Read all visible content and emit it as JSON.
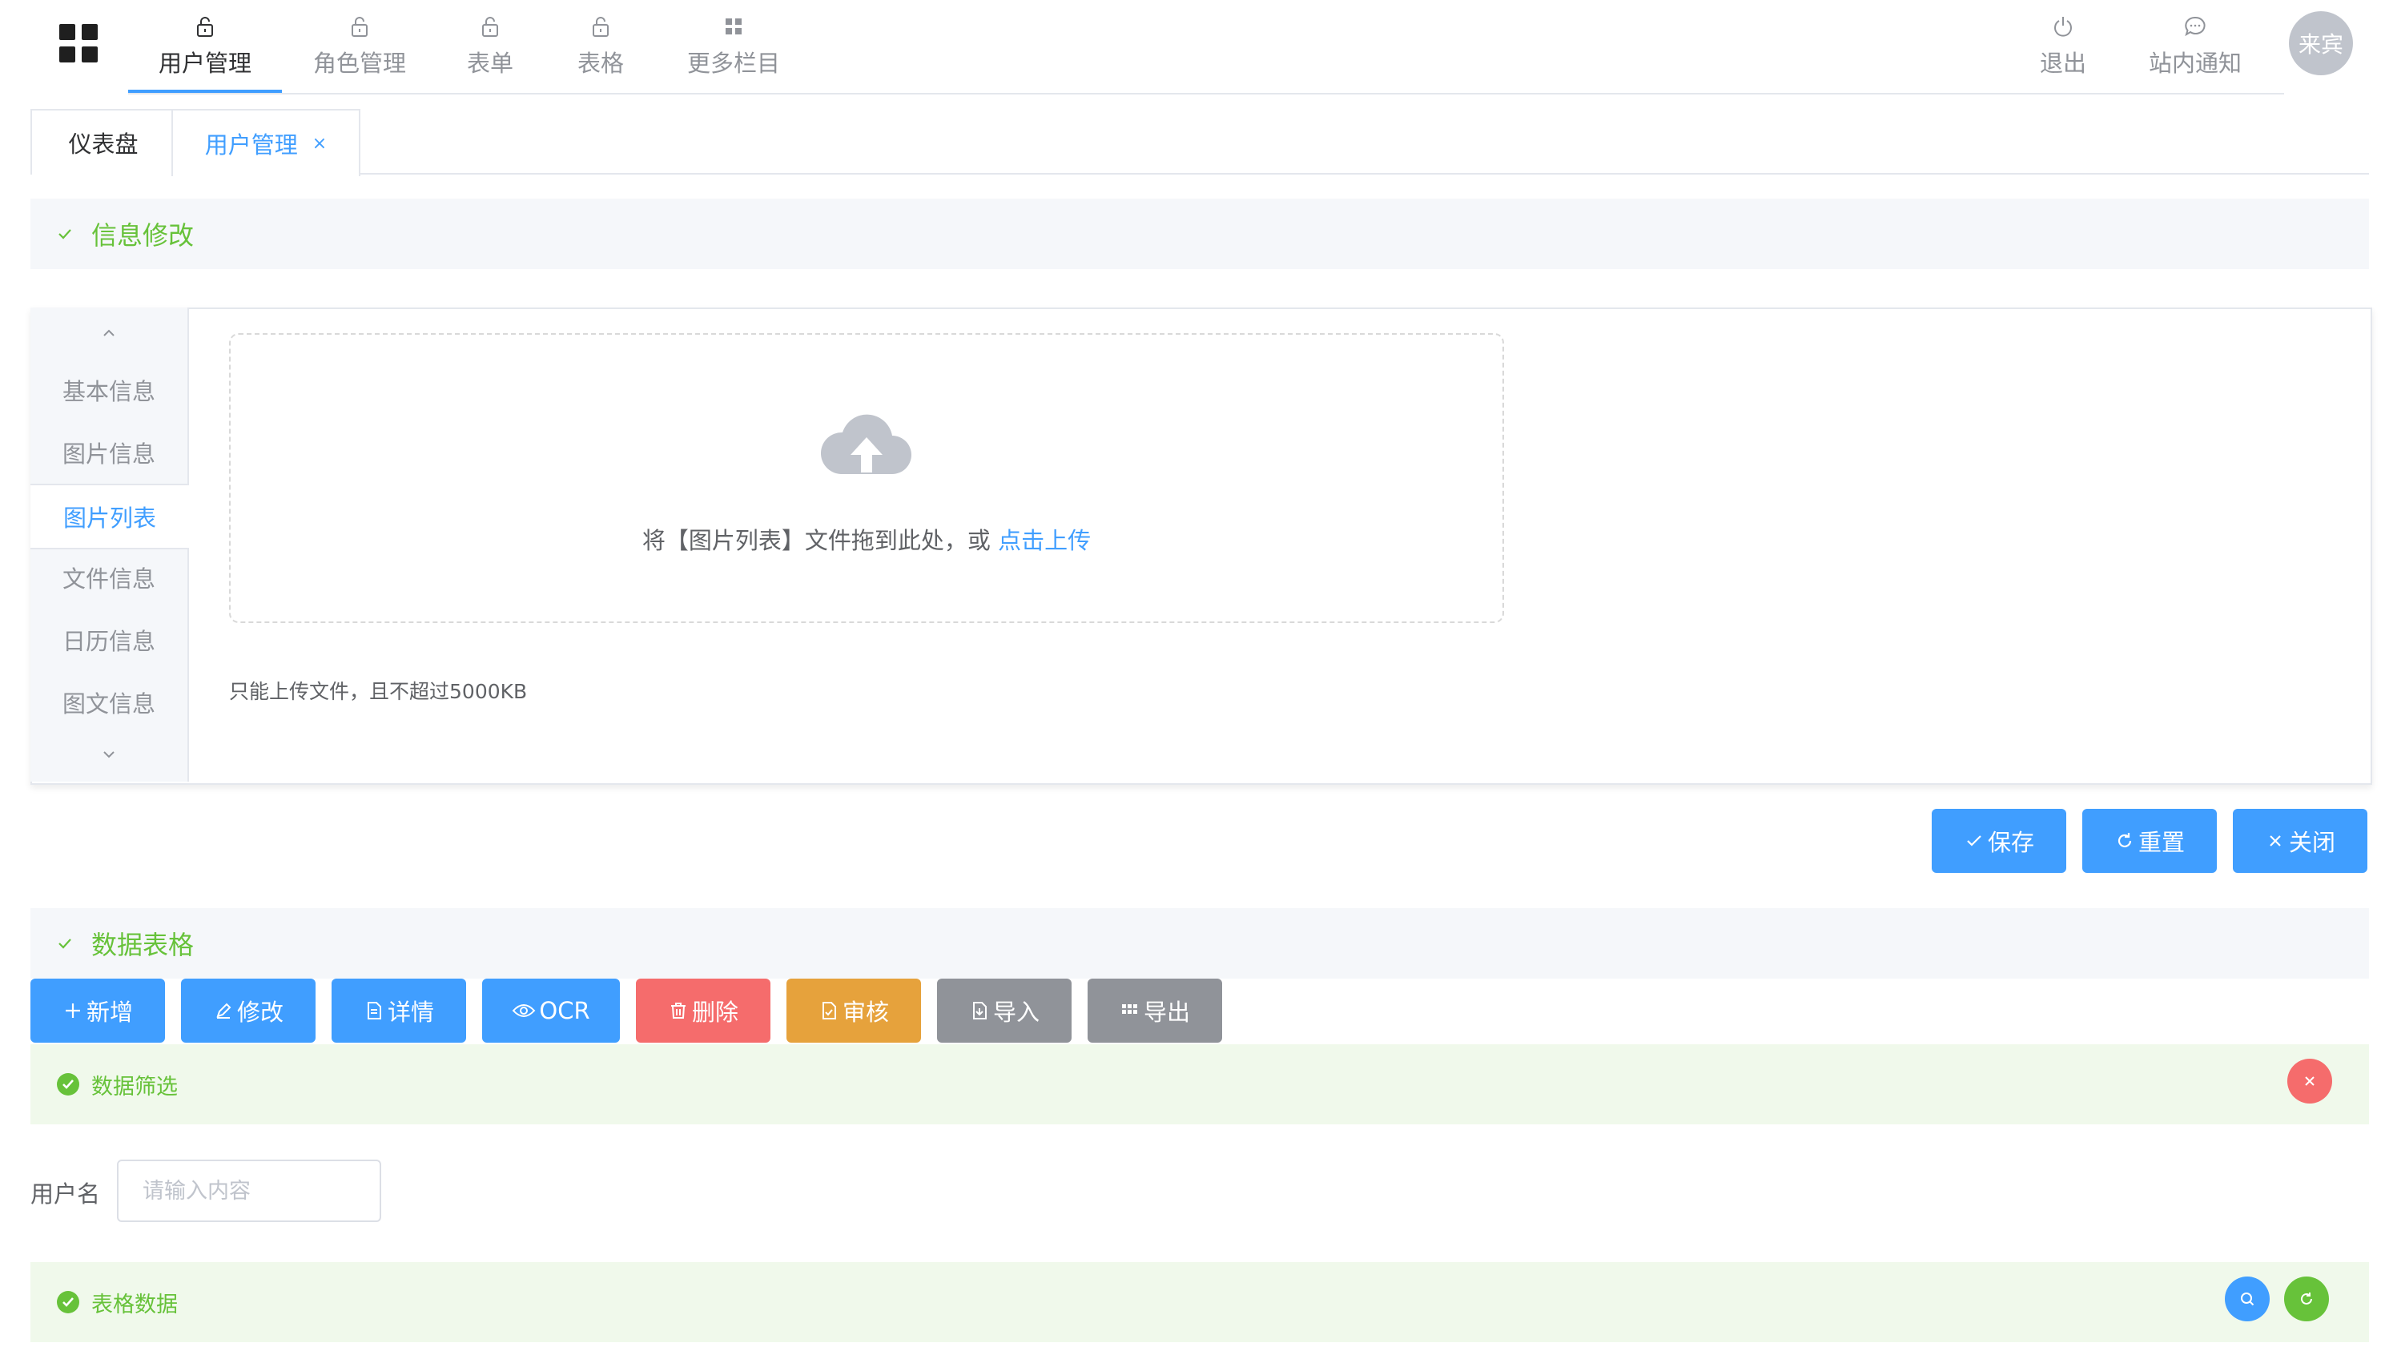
{
  "nav": {
    "items": [
      {
        "label": "用户管理",
        "icon": "lock-icon"
      },
      {
        "label": "角色管理",
        "icon": "lock-icon"
      },
      {
        "label": "表单",
        "icon": "lock-icon"
      },
      {
        "label": "表格",
        "icon": "lock-icon"
      },
      {
        "label": "更多栏目",
        "icon": "menu-grid-icon"
      }
    ],
    "right": [
      {
        "label": "退出",
        "icon": "power-icon"
      },
      {
        "label": "站内通知",
        "icon": "chat-icon"
      }
    ],
    "avatar": "来宾"
  },
  "tabs": [
    {
      "label": "仪表盘"
    },
    {
      "label": "用户管理",
      "close": "×"
    }
  ],
  "info_section": {
    "title": "信息修改"
  },
  "side_tabs": [
    "基本信息",
    "图片信息",
    "图片列表",
    "文件信息",
    "日历信息",
    "图文信息"
  ],
  "upload": {
    "text": "将【图片列表】文件拖到此处，或 ",
    "link": "点击上传",
    "tip": "只能上传文件，且不超过5000KB"
  },
  "form_actions": {
    "save": "保存",
    "reset": "重置",
    "close": "关闭"
  },
  "table_section": {
    "title": "数据表格"
  },
  "toolbar": {
    "add": "新增",
    "edit": "修改",
    "detail": "详情",
    "ocr": "OCR",
    "delete": "删除",
    "audit": "审核",
    "import": "导入",
    "export": "导出"
  },
  "filter": {
    "title": "数据筛选",
    "username_label": "用户名",
    "username_placeholder": "请输入内容"
  },
  "table_data": {
    "title": "表格数据"
  },
  "colors": {
    "primary": "#409eff",
    "success": "#67c23a",
    "danger": "#f56c6c",
    "warning": "#e6a23c",
    "info": "#909399"
  }
}
